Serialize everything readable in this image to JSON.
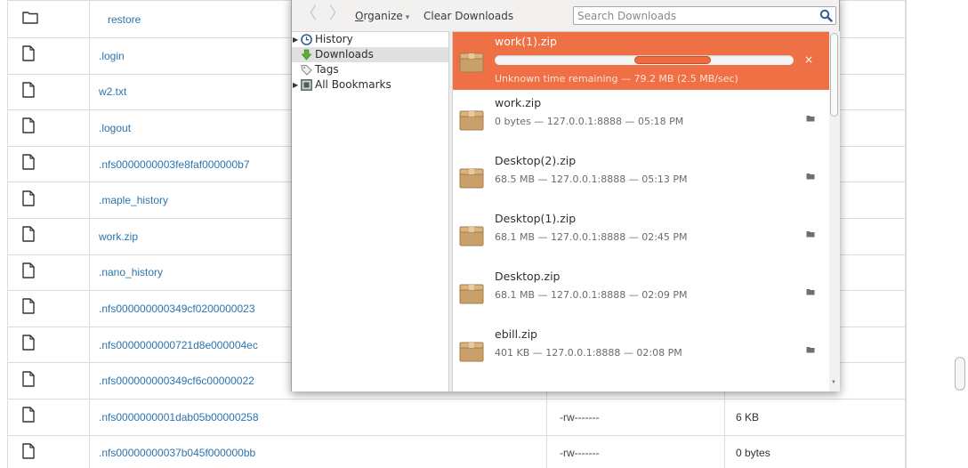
{
  "file_listing": {
    "rows": [
      {
        "name": "restore",
        "icon": "folder-icon",
        "permissions": "",
        "size": ""
      },
      {
        "name": ".login",
        "icon": "file-icon",
        "permissions": "",
        "size": ""
      },
      {
        "name": "w2.txt",
        "icon": "file-icon",
        "permissions": "",
        "size": ""
      },
      {
        "name": ".logout",
        "icon": "file-icon",
        "permissions": "",
        "size": ""
      },
      {
        "name": ".nfs0000000003fe8faf000000b7",
        "icon": "file-icon",
        "permissions": "",
        "size": ""
      },
      {
        "name": ".maple_history",
        "icon": "file-icon",
        "permissions": "",
        "size": ""
      },
      {
        "name": "work.zip",
        "icon": "file-icon",
        "permissions": "",
        "size": ""
      },
      {
        "name": ".nano_history",
        "icon": "file-icon",
        "permissions": "",
        "size": ""
      },
      {
        "name": ".nfs000000000349cf0200000023",
        "icon": "file-icon",
        "permissions": "",
        "size": ""
      },
      {
        "name": ".nfs0000000000721d8e000004ec",
        "icon": "file-icon",
        "permissions": "",
        "size": ""
      },
      {
        "name": ".nfs000000000349cf6c00000022",
        "icon": "file-icon",
        "permissions": "",
        "size": ""
      },
      {
        "name": ".nfs0000000001dab05b00000258",
        "icon": "file-icon",
        "permissions": "-rw-------",
        "size": "6 KB"
      },
      {
        "name": ".nfs00000000037b045f000000bb",
        "icon": "file-icon",
        "permissions": "-rw-------",
        "size": "0 bytes"
      }
    ]
  },
  "library": {
    "toolbar": {
      "back_glyph": "〈",
      "forward_glyph": "〉",
      "organize_first": "O",
      "organize_rest": "rganize",
      "organize_arrow": "▾",
      "clear_label": "Clear Downloads",
      "search_placeholder": "Search Downloads"
    },
    "sidebar": {
      "items": [
        {
          "label": "History",
          "icon": "clock-icon",
          "expandable": true,
          "selected": false
        },
        {
          "label": "Downloads",
          "icon": "download-arrow-icon",
          "expandable": false,
          "selected": true
        },
        {
          "label": "Tags",
          "icon": "tag-icon",
          "expandable": false,
          "selected": false
        },
        {
          "label": "All Bookmarks",
          "icon": "bookmarks-icon",
          "expandable": true,
          "selected": false
        }
      ]
    },
    "downloads": [
      {
        "name": "work(1).zip",
        "status": "Unknown time remaining — 79.2 MB (2.5 MB/sec)",
        "in_progress": true,
        "progress_indeterminate": true
      },
      {
        "name": "work.zip",
        "status": "0 bytes — 127.0.0.1:8888 — 05:18 PM",
        "in_progress": false
      },
      {
        "name": "Desktop(2).zip",
        "status": "68.5 MB — 127.0.0.1:8888 — 05:13 PM",
        "in_progress": false
      },
      {
        "name": "Desktop(1).zip",
        "status": "68.1 MB — 127.0.0.1:8888 — 02:45 PM",
        "in_progress": false
      },
      {
        "name": "Desktop.zip",
        "status": "68.1 MB — 127.0.0.1:8888 — 02:09 PM",
        "in_progress": false
      },
      {
        "name": "ebill.zip",
        "status": "401 KB — 127.0.0.1:8888 — 02:08 PM",
        "in_progress": false
      }
    ],
    "cancel_glyph": "×"
  },
  "colors": {
    "active_download_bg": "#f07046",
    "link": "#2b74ad",
    "progress_fill": "#ee6a3f"
  }
}
